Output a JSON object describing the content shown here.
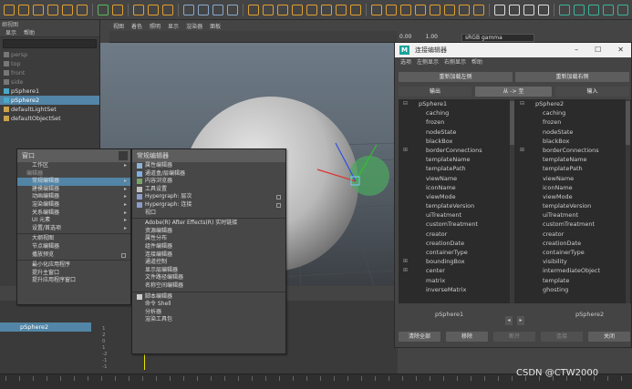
{
  "outliner": {
    "title": "纲视图",
    "menu": [
      "显示",
      "帮助"
    ],
    "items": [
      {
        "label": "persp",
        "dim": true
      },
      {
        "label": "top",
        "dim": true
      },
      {
        "label": "front",
        "dim": true
      },
      {
        "label": "side",
        "dim": true
      },
      {
        "label": "pSphere1",
        "dim": false
      },
      {
        "label": "pSphere2",
        "dim": false,
        "selected": true
      },
      {
        "label": "defaultLightSet",
        "dim": false
      },
      {
        "label": "defaultObjectSet",
        "dim": false
      }
    ]
  },
  "viewport": {
    "menu": [
      "视图",
      "着色",
      "照明",
      "显示",
      "渲染器",
      "面板"
    ],
    "gamma_label": "sRGB gamma",
    "gamma_values": [
      "0.00",
      "1.00"
    ]
  },
  "timeline": {
    "item": "pSphere2",
    "ticks": [
      "1",
      "2",
      "0",
      "1",
      "-2",
      "-1",
      "-1"
    ]
  },
  "window_menu": {
    "title": "窗口",
    "items": [
      {
        "label": "工作区",
        "arrow": true
      },
      {
        "label": "编辑器",
        "header": true
      },
      {
        "label": "常规编辑器",
        "arrow": true,
        "highlight": true
      },
      {
        "label": "建模编辑器",
        "arrow": true
      },
      {
        "label": "动画编辑器",
        "arrow": true
      },
      {
        "label": "渲染编辑器",
        "arrow": true
      },
      {
        "label": "关系编辑器",
        "arrow": true
      },
      {
        "label": "UI 元素",
        "arrow": true
      },
      {
        "label": "设置/首选项",
        "arrow": true
      },
      {
        "label": "大纲视图",
        "sep_before": true
      },
      {
        "label": "节点编辑器"
      },
      {
        "label": "播放预览",
        "checkbox": true
      },
      {
        "label": "最小化应用程序",
        "sep_before": true
      },
      {
        "label": "提升主窗口"
      },
      {
        "label": "提升应用程序窗口"
      }
    ]
  },
  "general_menu": {
    "title": "常规编辑器",
    "items": [
      {
        "label": "属性编辑器",
        "icon": "#8fb3d8"
      },
      {
        "label": "通道盒/层编辑器",
        "icon": "#7fb0e0"
      },
      {
        "label": "内容浏览器",
        "icon": "#7aa36a"
      },
      {
        "label": "工具设置",
        "icon": "#c0c0c0"
      },
      {
        "label": "Hypergraph: 层次",
        "icon": "#8d9dc8",
        "checkbox": true
      },
      {
        "label": "Hypergraph: 连接",
        "icon": "#8d9dc8",
        "checkbox": true
      },
      {
        "label": "视口",
        "icon": ""
      },
      {
        "label": "Adobe(R) After Effects(R) 实时链接",
        "sep_before": true
      },
      {
        "label": "资源编辑器"
      },
      {
        "label": "属性分布"
      },
      {
        "label": "组件编辑器"
      },
      {
        "label": "连接编辑器"
      },
      {
        "label": "通道控制"
      },
      {
        "label": "显示层编辑器"
      },
      {
        "label": "文件路径编辑器"
      },
      {
        "label": "名称空间编辑器"
      },
      {
        "label": "脚本编辑器",
        "sep_before": true,
        "icon": "#cfcfcf"
      },
      {
        "label": "命令 Shell"
      },
      {
        "label": "分析器"
      },
      {
        "label": "渲染工具包"
      }
    ]
  },
  "connection_editor": {
    "title": "连接编辑器",
    "menu": [
      "选项",
      "左侧显示",
      "右侧显示",
      "帮助"
    ],
    "reload_left": "重新加载左侧",
    "reload_right": "重新加载右侧",
    "output_label": "输出",
    "direction_label": "从 -> 至",
    "input_label": "输入",
    "left_node": "pSphere1",
    "right_node": "pSphere2",
    "left_attrs": [
      {
        "name": "pSphere1",
        "pm": "⊟",
        "indent": 0
      },
      {
        "name": "caching",
        "pm": ""
      },
      {
        "name": "frozen",
        "pm": ""
      },
      {
        "name": "nodeState",
        "pm": ""
      },
      {
        "name": "blackBox",
        "pm": ""
      },
      {
        "name": "borderConnections",
        "pm": "⊞"
      },
      {
        "name": "templateName",
        "pm": ""
      },
      {
        "name": "templatePath",
        "pm": ""
      },
      {
        "name": "viewName",
        "pm": ""
      },
      {
        "name": "iconName",
        "pm": ""
      },
      {
        "name": "viewMode",
        "pm": ""
      },
      {
        "name": "templateVersion",
        "pm": ""
      },
      {
        "name": "uiTreatment",
        "pm": ""
      },
      {
        "name": "customTreatment",
        "pm": ""
      },
      {
        "name": "creator",
        "pm": ""
      },
      {
        "name": "creationDate",
        "pm": ""
      },
      {
        "name": "containerType",
        "pm": ""
      },
      {
        "name": "boundingBox",
        "pm": "⊞"
      },
      {
        "name": "center",
        "pm": "⊞"
      },
      {
        "name": "matrix",
        "pm": ""
      },
      {
        "name": "inverseMatrix",
        "pm": ""
      }
    ],
    "right_attrs": [
      {
        "name": "pSphere2",
        "pm": "⊟",
        "indent": 0
      },
      {
        "name": "caching",
        "pm": ""
      },
      {
        "name": "frozen",
        "pm": ""
      },
      {
        "name": "nodeState",
        "pm": ""
      },
      {
        "name": "blackBox",
        "pm": ""
      },
      {
        "name": "borderConnections",
        "pm": "⊞"
      },
      {
        "name": "templateName",
        "pm": ""
      },
      {
        "name": "templatePath",
        "pm": ""
      },
      {
        "name": "viewName",
        "pm": ""
      },
      {
        "name": "iconName",
        "pm": ""
      },
      {
        "name": "viewMode",
        "pm": ""
      },
      {
        "name": "templateVersion",
        "pm": ""
      },
      {
        "name": "uiTreatment",
        "pm": ""
      },
      {
        "name": "customTreatment",
        "pm": ""
      },
      {
        "name": "creator",
        "pm": ""
      },
      {
        "name": "creationDate",
        "pm": ""
      },
      {
        "name": "containerType",
        "pm": ""
      },
      {
        "name": "visibility",
        "pm": ""
      },
      {
        "name": "intermediateObject",
        "pm": ""
      },
      {
        "name": "template",
        "pm": ""
      },
      {
        "name": "ghosting",
        "pm": ""
      }
    ],
    "buttons": {
      "clear_all": "清除全部",
      "remove": "移除",
      "break": "断开",
      "make": "连接",
      "close": "关闭"
    }
  },
  "watermark": "CSDN @CTW2000"
}
